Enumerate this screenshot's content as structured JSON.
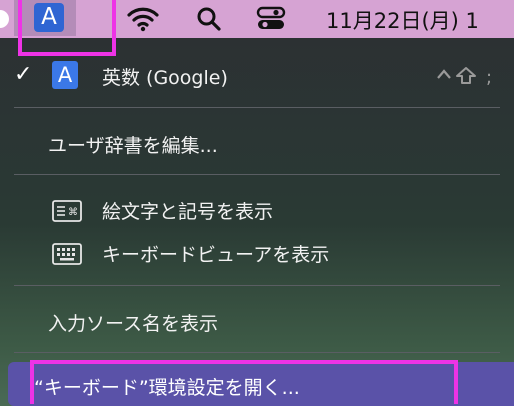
{
  "menubar": {
    "input_indicator": "A",
    "clock": "11月22日(月) 1",
    "icons": [
      "input-source-icon",
      "wifi-icon",
      "search-icon",
      "control-center-icon"
    ]
  },
  "menu": {
    "current_source": {
      "icon_letter": "A",
      "label": "英数 (Google)",
      "checked": true,
      "shortcut": "^⇧;"
    },
    "items": [
      {
        "label": "ユーザ辞書を編集..."
      },
      {
        "label": "絵文字と記号を表示",
        "icon": "emoji-keyboard-icon"
      },
      {
        "label": "キーボードビューアを表示",
        "icon": "keyboard-icon"
      },
      {
        "label": "入力ソース名を表示"
      },
      {
        "label": "“キーボード”環境設定を開く..."
      }
    ]
  },
  "colors": {
    "menubar_bg": "#d6a3d3",
    "highlight_box": "#ee33e6",
    "selection": "#5a52a8",
    "input_icon_bg": "#2f65d3"
  }
}
